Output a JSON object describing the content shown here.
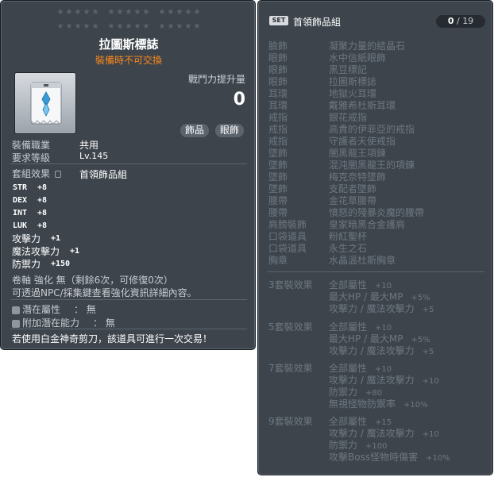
{
  "item": {
    "name": "拉圖斯標誌",
    "trade_note": "裝備時不可交換",
    "compare_label": "戰鬥力提升量",
    "compare_value": "0",
    "tags": [
      "飾品",
      "眼飾"
    ],
    "job_label": "裝備職業",
    "job_value": "共用",
    "level_label": "要求等級",
    "level_value": "Lv.145",
    "set_label": "套組效果",
    "set_name": "首領飾品組",
    "stats": [
      {
        "name": "STR",
        "value": "+8"
      },
      {
        "name": "DEX",
        "value": "+8"
      },
      {
        "name": "INT",
        "value": "+8"
      },
      {
        "name": "LUK",
        "value": "+8"
      },
      {
        "name": "攻擊力",
        "value": "+1"
      },
      {
        "name": "魔法攻擊力",
        "value": "+1"
      },
      {
        "name": "防禦力",
        "value": "+150"
      }
    ],
    "upgrade_line": "卷軸 強化 無（剩餘6次，可修復0次）",
    "npc_line": "可透過NPC/採集鍵查看強化資訊詳細內容。",
    "potential_label": "潛在屬性",
    "potential_value": "： 無",
    "additional_label": "附加潛在能力",
    "additional_value": "： 無",
    "scissors_note": "若使用白金神奇剪刀，該道具可進行一次交易！"
  },
  "set": {
    "badge": "SET",
    "title": "首領飾品組",
    "count_current": "0",
    "count_sep": "/",
    "count_total": "19",
    "pieces": [
      {
        "slot": "臉飾",
        "name": "凝聚力量的結晶石"
      },
      {
        "slot": "眼飾",
        "name": "水中信紙眼飾"
      },
      {
        "slot": "眼飾",
        "name": "黑豆標記"
      },
      {
        "slot": "眼飾",
        "name": "拉圖斯標誌"
      },
      {
        "slot": "耳環",
        "name": "地獄火耳環"
      },
      {
        "slot": "耳環",
        "name": "戴雅希杜斯耳環"
      },
      {
        "slot": "戒指",
        "name": "銀花戒指"
      },
      {
        "slot": "戒指",
        "name": "高貴的伊菲亞的戒指"
      },
      {
        "slot": "戒指",
        "name": "守護者天使戒指"
      },
      {
        "slot": "墜飾",
        "name": "闇黑龍王項鍊"
      },
      {
        "slot": "墜飾",
        "name": "混沌闇黑龍王的項鍊"
      },
      {
        "slot": "墜飾",
        "name": "梅克奈特墜飾"
      },
      {
        "slot": "墜飾",
        "name": "支配者墜飾"
      },
      {
        "slot": "腰帶",
        "name": "金花草腰帶"
      },
      {
        "slot": "腰帶",
        "name": "憤怒的殘暴炎魔的腰帶"
      },
      {
        "slot": "肩膀裝飾",
        "name": "皇家暗黑合金護肩"
      },
      {
        "slot": "口袋道具",
        "name": "粉紅聖杯"
      },
      {
        "slot": "口袋道具",
        "name": "永生之石"
      },
      {
        "slot": "胸章",
        "name": "水晶溫杜斯胸章"
      }
    ],
    "bonuses": [
      {
        "header": "3套裝效果",
        "lines": [
          {
            "text": "全部屬性",
            "value": "+10"
          },
          {
            "text": "最大HP / 最大MP",
            "value": "+5%"
          },
          {
            "text": "攻擊力 / 魔法攻擊力",
            "value": "+5"
          }
        ]
      },
      {
        "header": "5套裝效果",
        "lines": [
          {
            "text": "全部屬性",
            "value": "+10"
          },
          {
            "text": "最大HP / 最大MP",
            "value": "+5%"
          },
          {
            "text": "攻擊力 / 魔法攻擊力",
            "value": "+5"
          }
        ]
      },
      {
        "header": "7套裝效果",
        "lines": [
          {
            "text": "全部屬性",
            "value": "+10"
          },
          {
            "text": "攻擊力 / 魔法攻擊力",
            "value": "+10"
          },
          {
            "text": "防禦力",
            "value": "+80"
          },
          {
            "text": "無視怪物防禦率",
            "value": "+10%"
          }
        ]
      },
      {
        "header": "9套裝效果",
        "lines": [
          {
            "text": "全部屬性",
            "value": "+15"
          },
          {
            "text": "攻擊力 / 魔法攻擊力",
            "value": "+10"
          },
          {
            "text": "防禦力",
            "value": "+100"
          },
          {
            "text": "攻擊Boss怪物時傷害",
            "value": "+10%"
          }
        ]
      }
    ]
  },
  "colors": {
    "panel_bg": "#3d444c",
    "accent_orange": "#ff8a1c",
    "inactive_text": "#6e7780"
  }
}
